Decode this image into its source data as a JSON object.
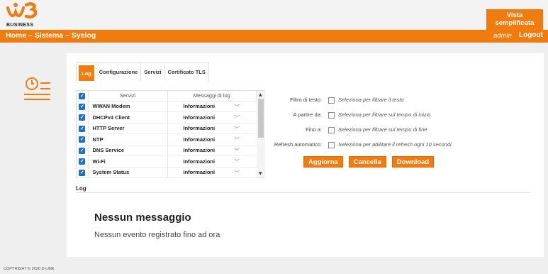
{
  "header": {
    "logo_text": "BUSINESS",
    "vista_button_line1": "Vista",
    "vista_button_line2": "semplificata"
  },
  "nav": {
    "breadcrumb": [
      "Home",
      "Sistema",
      "Syslog"
    ],
    "separator": " – ",
    "user": "admin",
    "logout": "Logout"
  },
  "tabs": [
    {
      "label": "Log",
      "active": true
    },
    {
      "label": "Configurazione",
      "active": false
    },
    {
      "label": "Servizi",
      "active": false
    },
    {
      "label": "Certificato TLS",
      "active": false
    }
  ],
  "table": {
    "headers": [
      "Servizi",
      "Messaggi di log"
    ],
    "rows": [
      {
        "checked": true,
        "service": "WWAN Modem",
        "level": "Informazioni"
      },
      {
        "checked": true,
        "service": "DHCPv4 Client",
        "level": "Informazioni"
      },
      {
        "checked": true,
        "service": "HTTP Server",
        "level": "Informazioni"
      },
      {
        "checked": true,
        "service": "NTP",
        "level": "Informazioni"
      },
      {
        "checked": true,
        "service": "DNS Service",
        "level": "Informazioni"
      },
      {
        "checked": true,
        "service": "Wi-Fi",
        "level": "Informazioni"
      },
      {
        "checked": true,
        "service": "System Status",
        "level": "Informazioni"
      }
    ]
  },
  "filters": [
    {
      "label": "Filtro di testo:",
      "hint": "Seleziona per filtrare il testo"
    },
    {
      "label": "A partire da:",
      "hint": "Seleziona per filtrare sul tempo di inizio"
    },
    {
      "label": "Fino a:",
      "hint": "Seleziona per filtrare sul tempo di fine"
    },
    {
      "label": "Refresh automatico:",
      "hint": "Seleziona per abilitare il refresh ogni 10 secondi"
    }
  ],
  "actions": {
    "update": "Aggiorna",
    "delete": "Cancella",
    "download": "Download"
  },
  "log": {
    "label": "Log",
    "empty_title": "Nessun messaggio",
    "empty_subtitle": "Nessun evento registrato fino ad ora"
  },
  "footer": "COPYRIGHT © 2020 D-LINK",
  "colors": {
    "accent": "#f07c10",
    "checkbox": "#1f6fd0"
  }
}
